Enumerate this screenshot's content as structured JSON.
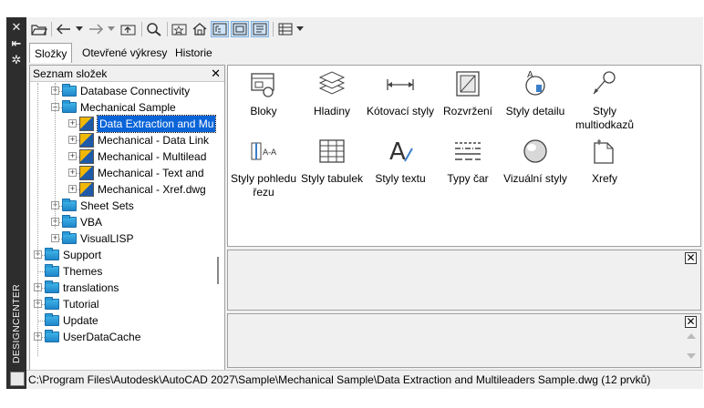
{
  "palette": {
    "title": "DESIGNCENTER",
    "close_glyph": "✕",
    "autohide_glyph": "⇤",
    "properties_glyph": "✲"
  },
  "toolbar": {
    "icons": [
      "load-icon",
      "back-icon",
      "forward-icon",
      "up-icon",
      "search-icon",
      "favorites-icon",
      "home-icon",
      "tree-view-icon",
      "preview-icon",
      "description-icon",
      "views-icon"
    ]
  },
  "tabs": [
    {
      "label": "Složky",
      "active": true
    },
    {
      "label": "Otevřené výkresy",
      "active": false
    },
    {
      "label": "Historie",
      "active": false
    }
  ],
  "tree": {
    "header": "Seznam složek",
    "close_glyph": "✕",
    "items": [
      {
        "label": "Database Connectivity",
        "type": "folder",
        "level": 1,
        "expander": "+"
      },
      {
        "label": "Mechanical Sample",
        "type": "folder",
        "level": 1,
        "expander": "−"
      },
      {
        "label": "Data Extraction and Mu",
        "type": "dwg",
        "level": 2,
        "expander": "+",
        "selected": true
      },
      {
        "label": "Mechanical - Data Link",
        "type": "dwg",
        "level": 2,
        "expander": "+"
      },
      {
        "label": "Mechanical - Multilead",
        "type": "dwg",
        "level": 2,
        "expander": "+"
      },
      {
        "label": "Mechanical - Text and",
        "type": "dwg",
        "level": 2,
        "expander": "+"
      },
      {
        "label": "Mechanical - Xref.dwg",
        "type": "dwg",
        "level": 2,
        "expander": "+"
      },
      {
        "label": "Sheet Sets",
        "type": "folder",
        "level": 1,
        "expander": "+"
      },
      {
        "label": "VBA",
        "type": "folder",
        "level": 1,
        "expander": "+"
      },
      {
        "label": "VisualLISP",
        "type": "folder",
        "level": 1,
        "expander": "+"
      },
      {
        "label": "Support",
        "type": "folder",
        "level": 0,
        "expander": "+"
      },
      {
        "label": "Themes",
        "type": "folder",
        "level": 0,
        "expander": ""
      },
      {
        "label": "translations",
        "type": "folder",
        "level": 0,
        "expander": "+"
      },
      {
        "label": "Tutorial",
        "type": "folder",
        "level": 0,
        "expander": "+"
      },
      {
        "label": "Update",
        "type": "folder",
        "level": 0,
        "expander": ""
      },
      {
        "label": "UserDataCache",
        "type": "folder",
        "level": 0,
        "expander": "+"
      }
    ]
  },
  "content": {
    "items": [
      {
        "label": "Bloky",
        "icon": "blocks-icon"
      },
      {
        "label": "Hladiny",
        "icon": "layers-icon"
      },
      {
        "label": "Kótovací styly",
        "icon": "dimstyles-icon"
      },
      {
        "label": "Rozvržení",
        "icon": "layouts-icon"
      },
      {
        "label": "Styly detailu",
        "icon": "detail-styles-icon"
      },
      {
        "label": "Styly multiodkazů",
        "icon": "multileader-styles-icon"
      },
      {
        "label": "Styly pohledu řezu",
        "icon": "section-view-styles-icon"
      },
      {
        "label": "Styly tabulek",
        "icon": "table-styles-icon"
      },
      {
        "label": "Styly textu",
        "icon": "text-styles-icon"
      },
      {
        "label": "Typy čar",
        "icon": "linetypes-icon"
      },
      {
        "label": "Vizuální styly",
        "icon": "visual-styles-icon"
      },
      {
        "label": "Xrefy",
        "icon": "xrefs-icon"
      }
    ]
  },
  "preview": {
    "close_glyph": "✕"
  },
  "description": {
    "close_glyph": "✕"
  },
  "status": {
    "path": "C:\\Program Files\\Autodesk\\AutoCAD 2027\\Sample\\Mechanical Sample\\Data Extraction and Multileaders Sample.dwg (12 prvků)"
  }
}
